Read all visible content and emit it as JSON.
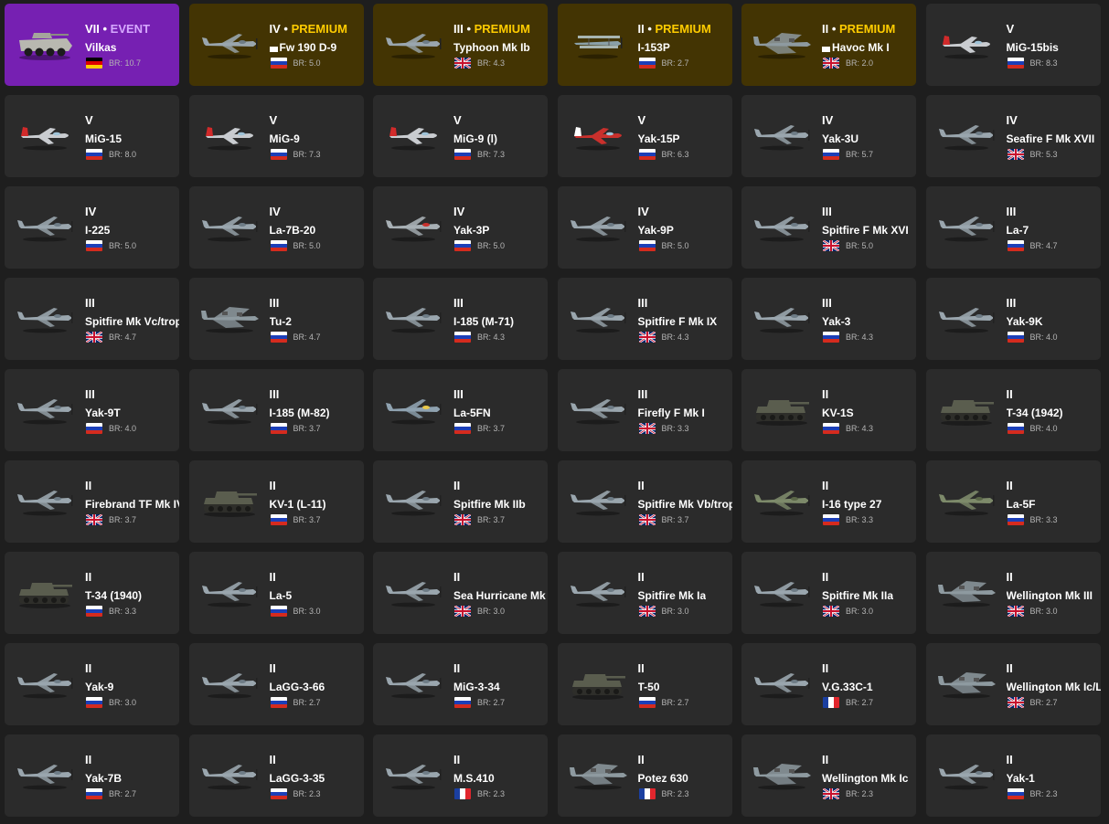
{
  "colors": {
    "background": "#1e1e1e",
    "card": "#2b2b2b",
    "premium_card": "#433403",
    "event_card": "#7620b2",
    "premium_text": "#ffcc00",
    "event_text": "#d6a8ff",
    "br_text": "#b4b4b4"
  },
  "vehicles": [
    {
      "rank": "VII",
      "tag": "EVENT",
      "name": "Vilkas",
      "country": "germany",
      "br": "BR: 10.7",
      "kind": "ifv",
      "style": "event"
    },
    {
      "rank": "IV",
      "tag": "PREMIUM",
      "name": "Fw 190 D-9",
      "country": "ussr",
      "br": "BR: 5.0",
      "kind": "plane",
      "style": "premium",
      "mark": true
    },
    {
      "rank": "III",
      "tag": "PREMIUM",
      "name": "Typhoon Mk Ib",
      "country": "uk",
      "br": "BR: 4.3",
      "kind": "plane",
      "style": "premium"
    },
    {
      "rank": "II",
      "tag": "PREMIUM",
      "name": "I-153P",
      "country": "ussr",
      "br": "BR: 2.7",
      "kind": "biplane",
      "style": "premium"
    },
    {
      "rank": "II",
      "tag": "PREMIUM",
      "name": "Havoc Mk I",
      "country": "uk",
      "br": "BR: 2.0",
      "kind": "bomber",
      "style": "premium",
      "mark": true
    },
    {
      "rank": "V",
      "tag": "",
      "name": "MiG-15bis",
      "country": "ussr",
      "br": "BR: 8.3",
      "kind": "jet",
      "style": "normal"
    },
    {
      "rank": "V",
      "tag": "",
      "name": "MiG-15",
      "country": "ussr",
      "br": "BR: 8.0",
      "kind": "jet",
      "style": "normal"
    },
    {
      "rank": "V",
      "tag": "",
      "name": "MiG-9",
      "country": "ussr",
      "br": "BR: 7.3",
      "kind": "jet",
      "style": "normal"
    },
    {
      "rank": "V",
      "tag": "",
      "name": "MiG-9 (l)",
      "country": "ussr",
      "br": "BR: 7.3",
      "kind": "jet",
      "style": "normal"
    },
    {
      "rank": "V",
      "tag": "",
      "name": "Yak-15P",
      "country": "ussr",
      "br": "BR: 6.3",
      "kind": "jet-red",
      "style": "normal"
    },
    {
      "rank": "IV",
      "tag": "",
      "name": "Yak-3U",
      "country": "ussr",
      "br": "BR: 5.7",
      "kind": "plane",
      "style": "normal"
    },
    {
      "rank": "IV",
      "tag": "",
      "name": "Seafire F Mk XVII",
      "country": "uk",
      "br": "BR: 5.3",
      "kind": "plane",
      "style": "normal"
    },
    {
      "rank": "IV",
      "tag": "",
      "name": "I-225",
      "country": "ussr",
      "br": "BR: 5.0",
      "kind": "plane",
      "style": "normal"
    },
    {
      "rank": "IV",
      "tag": "",
      "name": "La-7B-20",
      "country": "ussr",
      "br": "BR: 5.0",
      "kind": "plane",
      "style": "normal"
    },
    {
      "rank": "IV",
      "tag": "",
      "name": "Yak-3P",
      "country": "ussr",
      "br": "BR: 5.0",
      "kind": "plane-red",
      "style": "normal"
    },
    {
      "rank": "IV",
      "tag": "",
      "name": "Yak-9P",
      "country": "ussr",
      "br": "BR: 5.0",
      "kind": "plane",
      "style": "normal"
    },
    {
      "rank": "III",
      "tag": "",
      "name": "Spitfire F Mk XVI",
      "country": "uk",
      "br": "BR: 5.0",
      "kind": "plane",
      "style": "normal"
    },
    {
      "rank": "III",
      "tag": "",
      "name": "La-7",
      "country": "ussr",
      "br": "BR: 4.7",
      "kind": "plane",
      "style": "normal"
    },
    {
      "rank": "III",
      "tag": "",
      "name": "Spitfire Mk Vc/trop",
      "country": "uk",
      "br": "BR: 4.7",
      "kind": "plane",
      "style": "normal"
    },
    {
      "rank": "III",
      "tag": "",
      "name": "Tu-2",
      "country": "ussr",
      "br": "BR: 4.7",
      "kind": "bomber",
      "style": "normal"
    },
    {
      "rank": "III",
      "tag": "",
      "name": "I-185 (M-71)",
      "country": "ussr",
      "br": "BR: 4.3",
      "kind": "plane",
      "style": "normal"
    },
    {
      "rank": "III",
      "tag": "",
      "name": "Spitfire F Mk IX",
      "country": "uk",
      "br": "BR: 4.3",
      "kind": "plane",
      "style": "normal"
    },
    {
      "rank": "III",
      "tag": "",
      "name": "Yak-3",
      "country": "ussr",
      "br": "BR: 4.3",
      "kind": "plane",
      "style": "normal"
    },
    {
      "rank": "III",
      "tag": "",
      "name": "Yak-9K",
      "country": "ussr",
      "br": "BR: 4.0",
      "kind": "plane",
      "style": "normal"
    },
    {
      "rank": "III",
      "tag": "",
      "name": "Yak-9T",
      "country": "ussr",
      "br": "BR: 4.0",
      "kind": "plane",
      "style": "normal"
    },
    {
      "rank": "III",
      "tag": "",
      "name": "I-185 (M-82)",
      "country": "ussr",
      "br": "BR: 3.7",
      "kind": "plane",
      "style": "normal"
    },
    {
      "rank": "III",
      "tag": "",
      "name": "La-5FN",
      "country": "ussr",
      "br": "BR: 3.7",
      "kind": "plane-yellow",
      "style": "normal"
    },
    {
      "rank": "III",
      "tag": "",
      "name": "Firefly F Mk I",
      "country": "uk",
      "br": "BR: 3.3",
      "kind": "plane",
      "style": "normal"
    },
    {
      "rank": "II",
      "tag": "",
      "name": "KV-1S",
      "country": "ussr",
      "br": "BR: 4.3",
      "kind": "tank",
      "style": "normal"
    },
    {
      "rank": "II",
      "tag": "",
      "name": "T-34 (1942)",
      "country": "ussr",
      "br": "BR: 4.0",
      "kind": "tank",
      "style": "normal"
    },
    {
      "rank": "II",
      "tag": "",
      "name": "Firebrand TF Mk IV",
      "country": "uk",
      "br": "BR: 3.7",
      "kind": "plane",
      "style": "normal"
    },
    {
      "rank": "II",
      "tag": "",
      "name": "KV-1 (L-11)",
      "country": "ussr",
      "br": "BR: 3.7",
      "kind": "tank",
      "style": "normal"
    },
    {
      "rank": "II",
      "tag": "",
      "name": "Spitfire Mk IIb",
      "country": "uk",
      "br": "BR: 3.7",
      "kind": "plane",
      "style": "normal"
    },
    {
      "rank": "II",
      "tag": "",
      "name": "Spitfire Mk Vb/trop",
      "country": "uk",
      "br": "BR: 3.7",
      "kind": "plane",
      "style": "normal"
    },
    {
      "rank": "II",
      "tag": "",
      "name": "I-16 type 27",
      "country": "ussr",
      "br": "BR: 3.3",
      "kind": "plane-green",
      "style": "normal"
    },
    {
      "rank": "II",
      "tag": "",
      "name": "La-5F",
      "country": "ussr",
      "br": "BR: 3.3",
      "kind": "plane-green",
      "style": "normal"
    },
    {
      "rank": "II",
      "tag": "",
      "name": "T-34 (1940)",
      "country": "ussr",
      "br": "BR: 3.3",
      "kind": "tank",
      "style": "normal"
    },
    {
      "rank": "II",
      "tag": "",
      "name": "La-5",
      "country": "ussr",
      "br": "BR: 3.0",
      "kind": "plane",
      "style": "normal"
    },
    {
      "rank": "II",
      "tag": "",
      "name": "Sea Hurricane Mk IC",
      "country": "uk",
      "br": "BR: 3.0",
      "kind": "plane",
      "style": "normal"
    },
    {
      "rank": "II",
      "tag": "",
      "name": "Spitfire Mk Ia",
      "country": "uk",
      "br": "BR: 3.0",
      "kind": "plane",
      "style": "normal"
    },
    {
      "rank": "II",
      "tag": "",
      "name": "Spitfire Mk IIa",
      "country": "uk",
      "br": "BR: 3.0",
      "kind": "plane",
      "style": "normal"
    },
    {
      "rank": "II",
      "tag": "",
      "name": "Wellington Mk III",
      "country": "uk",
      "br": "BR: 3.0",
      "kind": "bomber",
      "style": "normal"
    },
    {
      "rank": "II",
      "tag": "",
      "name": "Yak-9",
      "country": "ussr",
      "br": "BR: 3.0",
      "kind": "plane",
      "style": "normal"
    },
    {
      "rank": "II",
      "tag": "",
      "name": "LaGG-3-66",
      "country": "ussr",
      "br": "BR: 2.7",
      "kind": "plane",
      "style": "normal"
    },
    {
      "rank": "II",
      "tag": "",
      "name": "MiG-3-34",
      "country": "ussr",
      "br": "BR: 2.7",
      "kind": "plane",
      "style": "normal"
    },
    {
      "rank": "II",
      "tag": "",
      "name": "T-50",
      "country": "ussr",
      "br": "BR: 2.7",
      "kind": "tank",
      "style": "normal"
    },
    {
      "rank": "II",
      "tag": "",
      "name": "V.G.33C-1",
      "country": "france",
      "br": "BR: 2.7",
      "kind": "plane",
      "style": "normal"
    },
    {
      "rank": "II",
      "tag": "",
      "name": "Wellington Mk Ic/L",
      "country": "uk",
      "br": "BR: 2.7",
      "kind": "bomber",
      "style": "normal"
    },
    {
      "rank": "II",
      "tag": "",
      "name": "Yak-7B",
      "country": "ussr",
      "br": "BR: 2.7",
      "kind": "plane",
      "style": "normal"
    },
    {
      "rank": "II",
      "tag": "",
      "name": "LaGG-3-35",
      "country": "ussr",
      "br": "BR: 2.3",
      "kind": "plane",
      "style": "normal"
    },
    {
      "rank": "II",
      "tag": "",
      "name": "M.S.410",
      "country": "france",
      "br": "BR: 2.3",
      "kind": "plane",
      "style": "normal"
    },
    {
      "rank": "II",
      "tag": "",
      "name": "Potez 630",
      "country": "france",
      "br": "BR: 2.3",
      "kind": "bomber",
      "style": "normal"
    },
    {
      "rank": "II",
      "tag": "",
      "name": "Wellington Mk Ic",
      "country": "uk",
      "br": "BR: 2.3",
      "kind": "bomber",
      "style": "normal"
    },
    {
      "rank": "II",
      "tag": "",
      "name": "Yak-1",
      "country": "ussr",
      "br": "BR: 2.3",
      "kind": "plane",
      "style": "normal"
    }
  ]
}
